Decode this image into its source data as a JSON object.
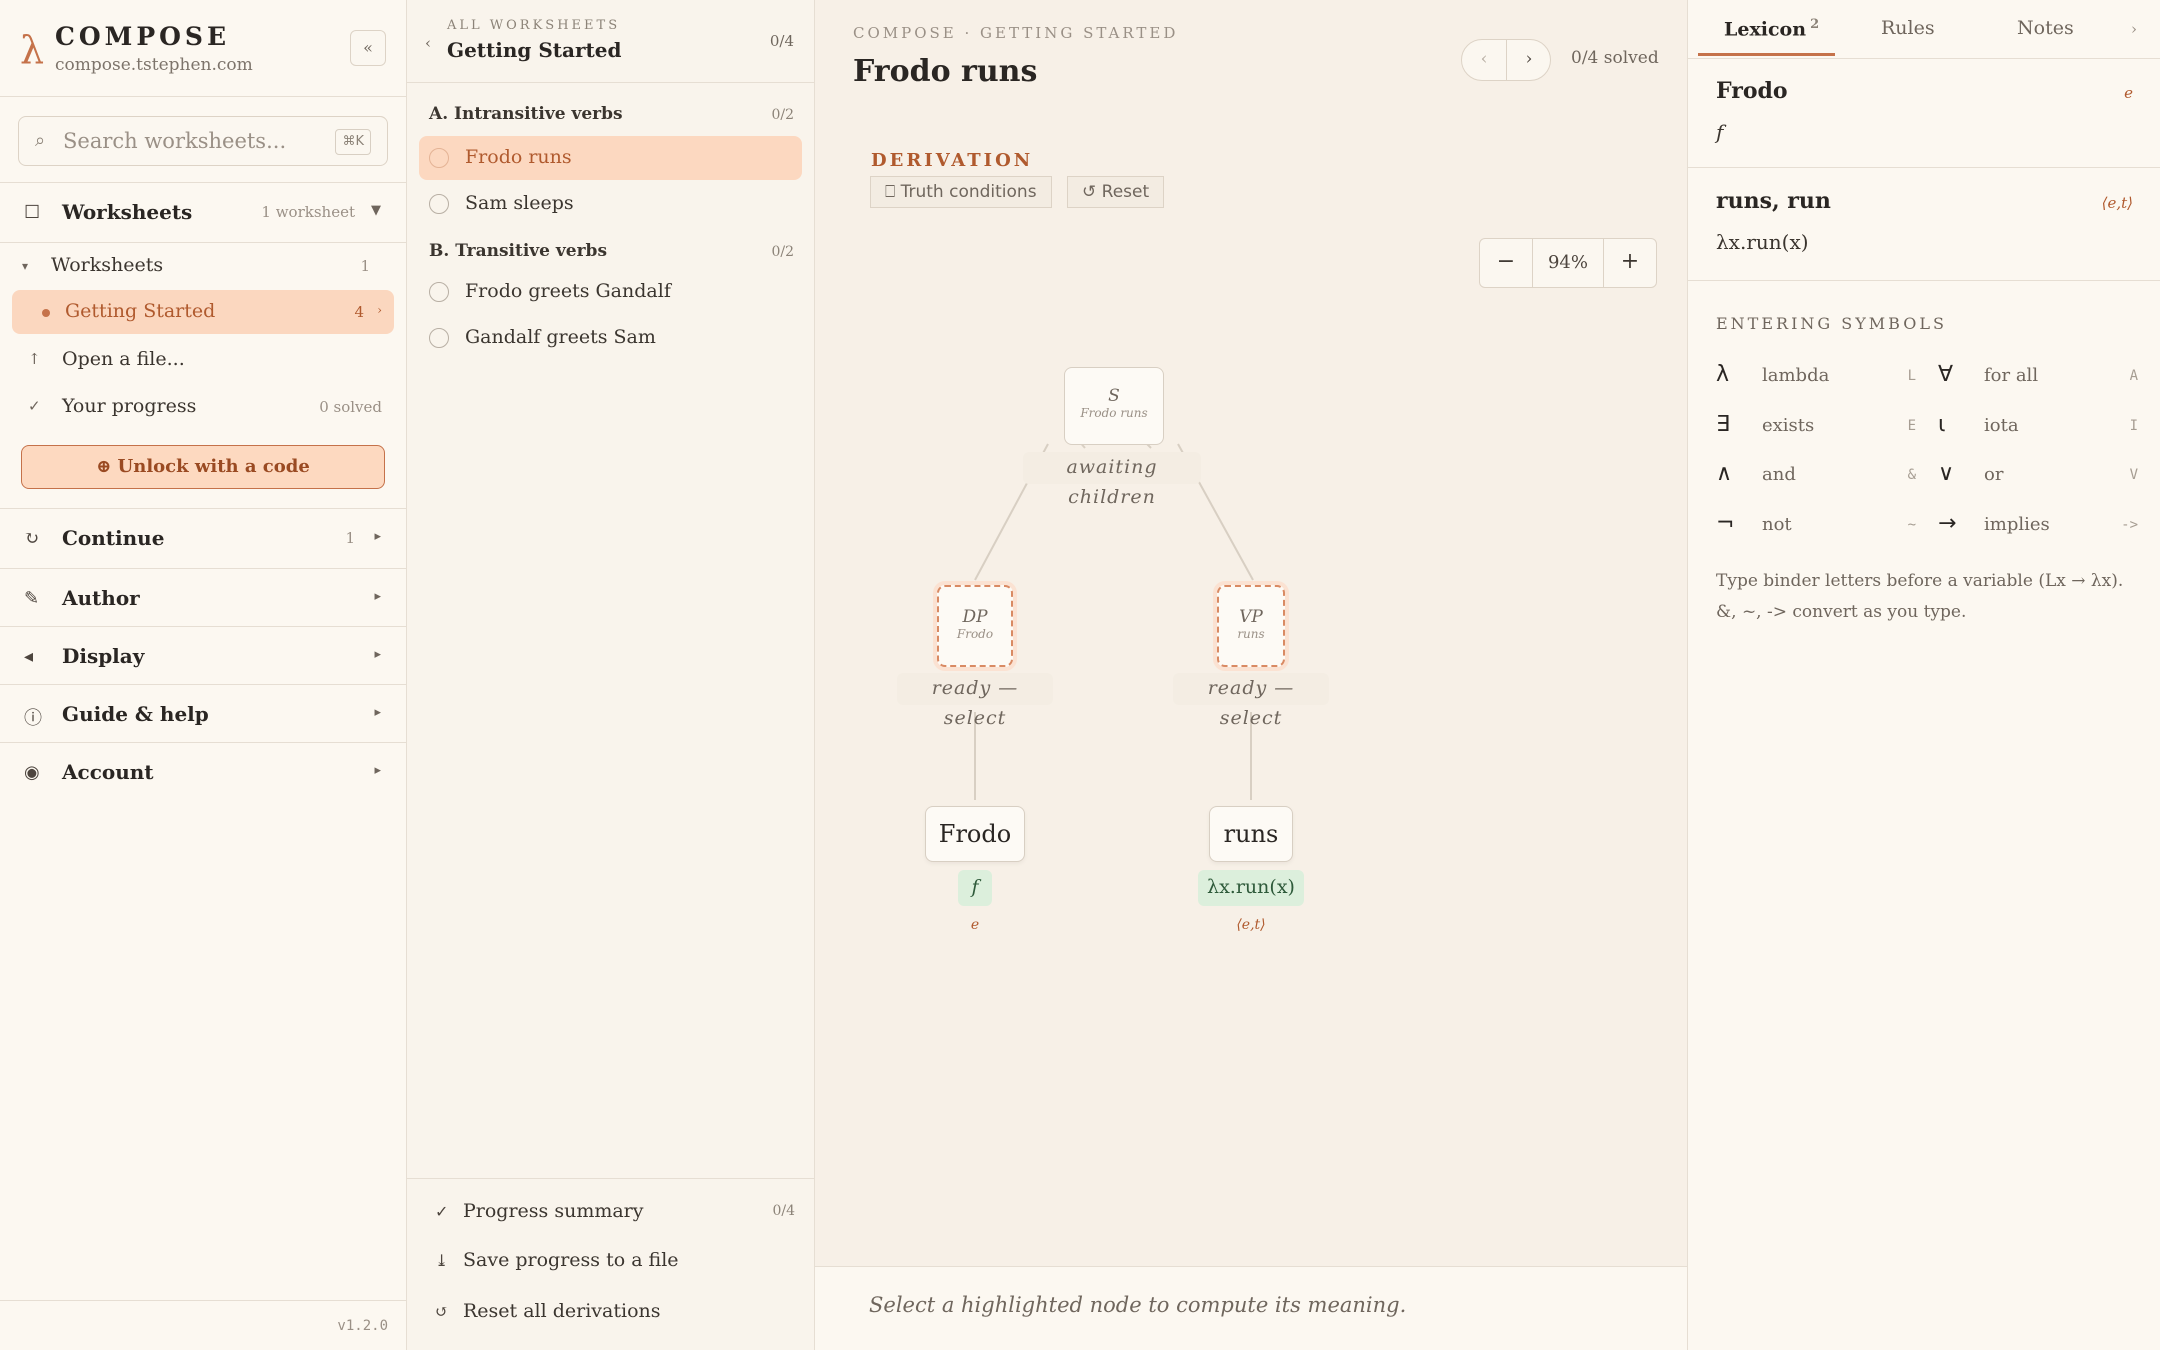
{
  "brand": {
    "logo": "λ",
    "name": "COMPOSE",
    "url": "compose.tstephen.com",
    "collapse": "«"
  },
  "search": {
    "placeholder": "Search worksheets...",
    "shortcut": "⌘K",
    "icon": "search-icon"
  },
  "sidebar": {
    "worksheets_head": {
      "label": "Worksheets",
      "meta": "1 worksheet",
      "arrow": "▼"
    },
    "worksheets_group": {
      "label": "Worksheets",
      "count": "1",
      "arrow": "▾"
    },
    "getting_started": {
      "label": "Getting Started",
      "count": "4",
      "arrow": "›"
    },
    "open_file": {
      "label": "Open a file..."
    },
    "progress": {
      "label": "Your progress",
      "meta": "0 solved"
    },
    "unlock": "⊕ Unlock with a code",
    "sections": [
      {
        "label": "Continue",
        "meta": "1",
        "arrow": "▸"
      },
      {
        "label": "Author",
        "arrow": "▸"
      },
      {
        "label": "Display",
        "arrow": "▸"
      },
      {
        "label": "Guide & help",
        "arrow": "▸"
      },
      {
        "label": "Account",
        "arrow": "▸"
      }
    ],
    "version": "v1.2.0"
  },
  "worksheet": {
    "back": "‹",
    "eyebrow": "ALL WORKSHEETS",
    "title": "Getting Started",
    "count": "0/4",
    "groups": [
      {
        "label": "A. Intransitive verbs",
        "count": "0/2",
        "items": [
          "Frodo runs",
          "Sam sleeps"
        ]
      },
      {
        "label": "B. Transitive verbs",
        "count": "0/2",
        "items": [
          "Frodo greets Gandalf",
          "Gandalf greets Sam"
        ]
      }
    ],
    "footer": [
      {
        "icon": "✓",
        "label": "Progress summary",
        "meta": "0/4"
      },
      {
        "icon": "⤓",
        "label": "Save progress to a file"
      },
      {
        "icon": "↺",
        "label": "Reset all derivations"
      }
    ]
  },
  "main": {
    "breadcrumb": "COMPOSE · GETTING STARTED",
    "title": "Frodo runs",
    "prev": "‹",
    "next": "›",
    "solved": "0/4 solved",
    "derivation_label": "DERIVATION",
    "truth_conditions": "⎕ Truth conditions",
    "reset": "↺ Reset",
    "zoom": {
      "minus": "−",
      "value": "94%",
      "plus": "+"
    },
    "tree": {
      "s": {
        "cat": "S",
        "sub": "Frodo runs",
        "status": "awaiting children"
      },
      "dp": {
        "cat": "DP",
        "sub": "Frodo",
        "status": "ready — select"
      },
      "vp": {
        "cat": "VP",
        "sub": "runs",
        "status": "ready — select"
      },
      "frodo": {
        "word": "Frodo",
        "den": "f",
        "type": "e"
      },
      "runs": {
        "word": "runs",
        "den": "λx.run(x)",
        "type": "⟨e,t⟩"
      }
    },
    "footer_msg": "Select a highlighted node to compute its meaning."
  },
  "right": {
    "tabs": [
      {
        "label": "Lexicon",
        "badge": "2"
      },
      {
        "label": "Rules"
      },
      {
        "label": "Notes"
      }
    ],
    "more": "›",
    "lexicon": [
      {
        "word": "Frodo",
        "type": "e",
        "den": "f"
      },
      {
        "word": "runs, run",
        "type": "⟨e,t⟩",
        "den": "λx.run(x)"
      }
    ],
    "symbols_head": "ENTERING SYMBOLS",
    "symbols": [
      {
        "glyph": "λ",
        "name": "lambda",
        "key": "L"
      },
      {
        "glyph": "∀",
        "name": "for all",
        "key": "A"
      },
      {
        "glyph": "∃",
        "name": "exists",
        "key": "E"
      },
      {
        "glyph": "ι",
        "name": "iota",
        "key": "I"
      },
      {
        "glyph": "∧",
        "name": "and",
        "key": "&"
      },
      {
        "glyph": "∨",
        "name": "or",
        "key": "V"
      },
      {
        "glyph": "¬",
        "name": "not",
        "key": "~"
      },
      {
        "glyph": "→",
        "name": "implies",
        "key": "->"
      }
    ],
    "hint": "Type binder letters before a variable (Lx → λx). &, ~, -> convert as you type."
  },
  "colors": {
    "accent": "#c5724a",
    "accent_bg": "#fbd7bf",
    "den_bg": "#dcefdc"
  }
}
